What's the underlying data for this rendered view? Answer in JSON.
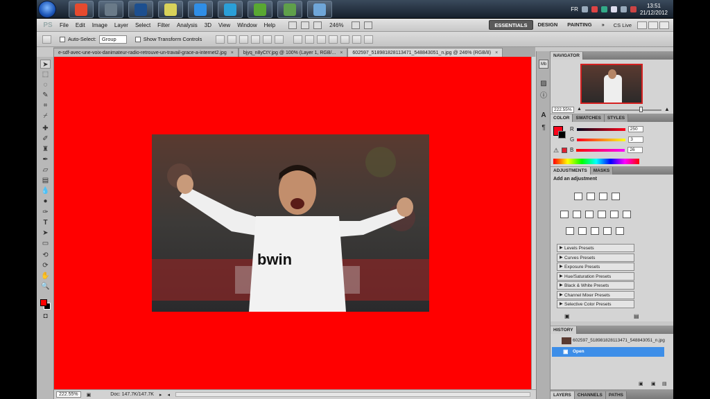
{
  "taskbar": {
    "apps": [
      {
        "icon": "chrome-icon",
        "color": "#e64a2e"
      },
      {
        "icon": "counter-strike-icon",
        "color": "#6a7a88"
      },
      {
        "icon": "photoshop-icon",
        "color": "#1d4f8f"
      },
      {
        "icon": "notes-icon",
        "color": "#d8d25a"
      },
      {
        "icon": "ie-icon",
        "color": "#2f8ee6"
      },
      {
        "icon": "teamviewer-icon",
        "color": "#2a9fd8"
      },
      {
        "icon": "utorrent-icon",
        "color": "#59a832"
      },
      {
        "icon": "phone-app-icon",
        "color": "#5fa04a"
      },
      {
        "icon": "window-app-icon",
        "color": "#6fa6d8"
      }
    ],
    "language": "FR",
    "time": "13:51",
    "date": "21/12/2012"
  },
  "menubar": {
    "logo": "PS",
    "items": [
      "File",
      "Edit",
      "Image",
      "Layer",
      "Select",
      "Filter",
      "Analysis",
      "3D",
      "View",
      "Window",
      "Help"
    ],
    "zoom": "246%",
    "workspaces": [
      "ESSENTIALS",
      "DESIGN",
      "PAINTING"
    ],
    "more": "»",
    "cslive": "CS Live"
  },
  "options": {
    "auto_select_label": "Auto-Select:",
    "auto_select_value": "Group",
    "show_transform_label": "Show Transform Controls"
  },
  "tabs": [
    {
      "label": "e-sdf-avec-une-voix-danimateur-radio-retrouve-un-travail-grace-a-internet2.jpg",
      "active": false
    },
    {
      "label": "bjyq_n8yCtY.jpg @ 100% (Layer 1, RGB/...",
      "active": false
    },
    {
      "label": "602597_518981828113471_548843051_n.jpg @ 246% (RGB/8)",
      "active": true
    }
  ],
  "status": {
    "zoom": "222.55%",
    "doc": "Doc: 147.7K/147.7K"
  },
  "navigator": {
    "title": "NAVIGATOR",
    "zoom": "222.55%"
  },
  "color_panel": {
    "tabs": [
      "COLOR",
      "SWATCHES",
      "STYLES"
    ],
    "r_label": "R",
    "g_label": "G",
    "b_label": "B",
    "r": "250",
    "g": "3",
    "b": "26",
    "fg_color": "#fa031a"
  },
  "adjustments": {
    "tabs": [
      "ADJUSTMENTS",
      "MASKS"
    ],
    "heading": "Add an adjustment",
    "presets": [
      "Levels Presets",
      "Curves Presets",
      "Exposure Presets",
      "Hue/Saturation Presets",
      "Black & White Presets",
      "Channel Mixer Presets",
      "Selective Color Presets"
    ]
  },
  "history": {
    "title": "HISTORY",
    "snapshot": "602597_518981828113471_548843051_n.jpg",
    "step": "Open"
  },
  "layers_tabs": [
    "LAYERS",
    "CHANNELS",
    "PATHS"
  ],
  "photo": {
    "shirt_text": "bwin"
  }
}
